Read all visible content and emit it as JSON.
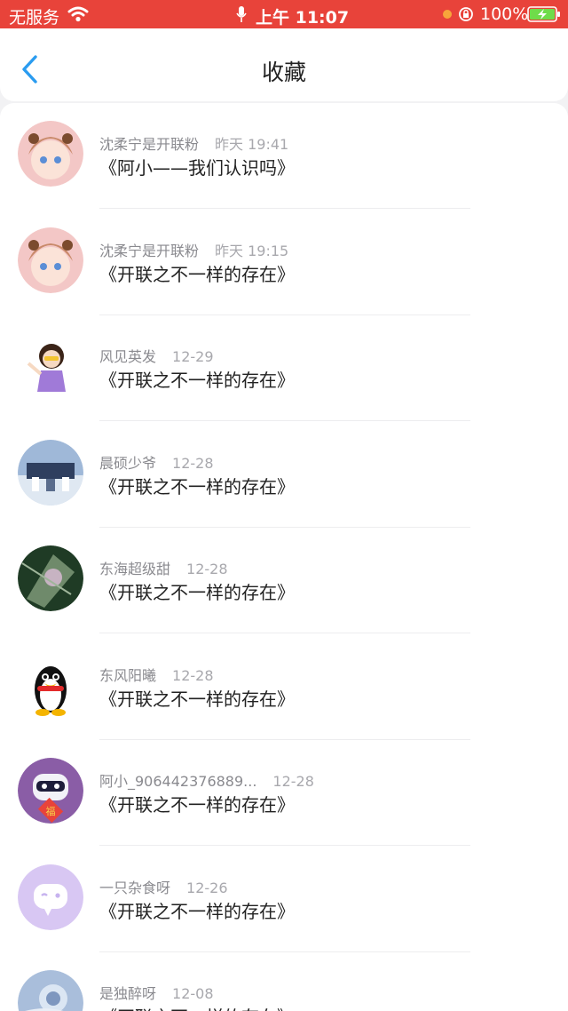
{
  "status_bar": {
    "carrier": "无服务",
    "time": "上午 11:07",
    "battery": "100%"
  },
  "nav": {
    "title": "收藏"
  },
  "items": [
    {
      "author": "沈柔宁是开联粉",
      "date": "昨天 19:41",
      "title": "《阿小——我们认识吗》",
      "avatar_color": "#f3c7c6"
    },
    {
      "author": "沈柔宁是开联粉",
      "date": "昨天 19:15",
      "title": "《开联之不一样的存在》",
      "avatar_color": "#f3c7c6"
    },
    {
      "author": "风见英发",
      "date": "12-29",
      "title": "《开联之不一样的存在》",
      "avatar_color": "#ffffff"
    },
    {
      "author": "晨硕少爷",
      "date": "12-28",
      "title": "《开联之不一样的存在》",
      "avatar_color": "#9fb8d8"
    },
    {
      "author": "东海超级甜",
      "date": "12-28",
      "title": "《开联之不一样的存在》",
      "avatar_color": "#1f3b25"
    },
    {
      "author": "东风阳曦",
      "date": "12-28",
      "title": "《开联之不一样的存在》",
      "avatar_color": "#ffffff"
    },
    {
      "author": "阿小_906442376889...",
      "date": "12-28",
      "title": "《开联之不一样的存在》",
      "avatar_color": "#8a5da6"
    },
    {
      "author": "一只杂食呀",
      "date": "12-26",
      "title": "《开联之不一样的存在》",
      "avatar_color": "#d8c7f3"
    },
    {
      "author": "是独醉呀",
      "date": "12-08",
      "title": "《开联之不一样的存在》",
      "avatar_color": "#a9bedb"
    }
  ],
  "colors": {
    "status_bar": "#e8433a",
    "accent": "#2a9cf0"
  }
}
